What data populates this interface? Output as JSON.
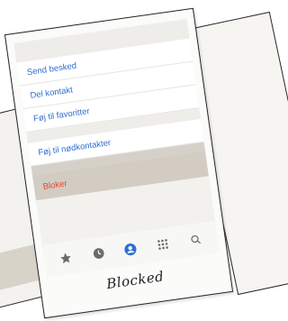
{
  "menu": {
    "items": [
      {
        "label": "Send besked"
      },
      {
        "label": "Del kontakt"
      },
      {
        "label": "Føj til favoritter"
      },
      {
        "label": "Føj til nødkontakter"
      },
      {
        "label": "Bloker"
      }
    ]
  },
  "tabbar": {
    "icons": [
      "star-icon",
      "clock-icon",
      "contacts-icon",
      "keypad-icon",
      "search-icon"
    ],
    "active": "contacts-icon"
  },
  "colors": {
    "link_blue": "#2f6fd0",
    "destructive_red": "#e2483a",
    "active_tab": "#2f6fd0",
    "inactive_tab": "#6b6b6b"
  },
  "caption": "Blocked"
}
